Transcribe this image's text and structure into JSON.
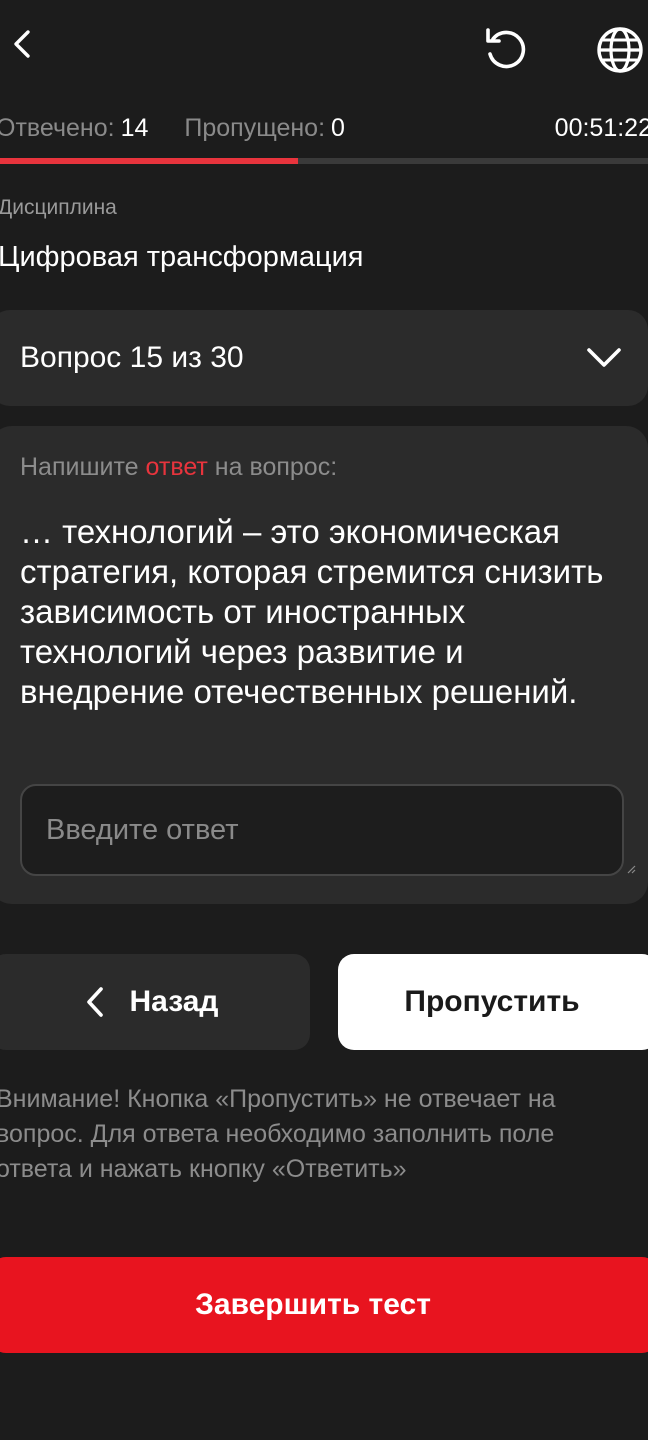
{
  "header": {
    "back_icon": "chevron-left-icon",
    "reset_icon": "reset-icon",
    "language_icon": "globe-icon"
  },
  "stats": {
    "answered_label": "Отвечено:",
    "answered_value": "14",
    "skipped_label": "Пропущено:",
    "skipped_value": "0",
    "timer": "00:51:22"
  },
  "progress": {
    "answered_fraction": 0.46,
    "fill_color": "#e8343d",
    "track_color": "#3a3a3a"
  },
  "discipline": {
    "label": "Дисциплина",
    "value": "Цифровая трансформация"
  },
  "question_selector": {
    "label": "Вопрос 15 из 30",
    "icon": "chevron-down-icon"
  },
  "question": {
    "prompt_before": "Напишите ",
    "prompt_accent": "ответ",
    "prompt_after": " на вопрос:",
    "text": "… технологий – это экономическая стратегия, которая стремится снизить зависимость от иностранных технологий через развитие и внедрение отечественных решений.",
    "answer_placeholder": "Введите ответ",
    "answer_value": ""
  },
  "buttons": {
    "back_label": "Назад",
    "skip_label": "Пропустить",
    "finish_label": "Завершить тест"
  },
  "notice": "Внимание! Кнопка «Пропустить» не отвечает на вопрос. Для ответа необходимо заполнить поле ответа и нажать кнопку «Ответить»",
  "colors": {
    "background": "#1c1c1c",
    "surface": "#2b2b2b",
    "accent": "#e8343d",
    "finish_button": "#e8141f"
  }
}
